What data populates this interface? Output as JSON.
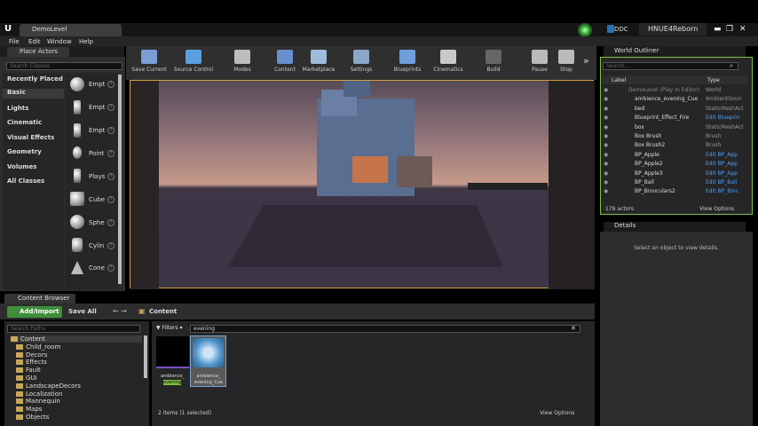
{
  "window": {
    "doc_tab": "DemoLevel",
    "project": "HNUE4Reborn",
    "ddc": "DDC"
  },
  "menu": [
    "File",
    "Edit",
    "Window",
    "Help"
  ],
  "place_actors": {
    "tab": "Place Actors",
    "search_placeholder": "Search Classes",
    "categories": [
      "Recently Placed",
      "Basic",
      "Lights",
      "Cinematic",
      "Visual Effects",
      "Geometry",
      "Volumes",
      "All Classes"
    ],
    "items": [
      "Empt",
      "Empt",
      "Empt",
      "Point",
      "Plays",
      "Cube",
      "Sphe",
      "Cylin",
      "Cone"
    ]
  },
  "toolbar": [
    {
      "label": "Save Current",
      "color": "#7a9fd6"
    },
    {
      "label": "Source Control",
      "color": "#5aa0e0"
    },
    {
      "label": "Modes",
      "color": "#bdbdbd"
    },
    {
      "label": "Content",
      "color": "#6a8fd0"
    },
    {
      "label": "Marketplace",
      "color": "#9ebbdc"
    },
    {
      "label": "Settings",
      "color": "#8aa6c8"
    },
    {
      "label": "Blueprints",
      "color": "#6f9edc"
    },
    {
      "label": "Cinematics",
      "color": "#c9c9c9"
    },
    {
      "label": "Build",
      "color": "#666666"
    },
    {
      "label": "Pause",
      "color": "#bbbbbb"
    },
    {
      "label": "Stop",
      "color": "#bbbbbb"
    }
  ],
  "outliner": {
    "tab": "World Outliner",
    "search_placeholder": "Search...",
    "col_label": "Label",
    "col_type": "Type",
    "rows": [
      {
        "label": "DemoLevel (Play In Editor)",
        "type": "World",
        "link": false
      },
      {
        "label": "ambience_evening_Cue",
        "type": "AmbientSoun",
        "link": false
      },
      {
        "label": "bed",
        "type": "StaticMeshAct",
        "link": false
      },
      {
        "label": "Blueprint_Effect_Fire",
        "type": "Edit Blueprin",
        "link": true
      },
      {
        "label": "box",
        "type": "StaticMeshAct",
        "link": false
      },
      {
        "label": "Box Brush",
        "type": "Brush",
        "link": false
      },
      {
        "label": "Box Brush2",
        "type": "Brush",
        "link": false
      },
      {
        "label": "BP_Apple",
        "type": "Edit BP_App",
        "link": true
      },
      {
        "label": "BP_Apple2",
        "type": "Edit BP_App",
        "link": true
      },
      {
        "label": "BP_Apple3",
        "type": "Edit BP_App",
        "link": true
      },
      {
        "label": "BP_Ball",
        "type": "Edit BP_Ball",
        "link": true
      },
      {
        "label": "BP_Binoculars2",
        "type": "Edit BP_Binc",
        "link": true
      }
    ],
    "count": "179 actors",
    "view_options": "View Options"
  },
  "details": {
    "tab": "Details",
    "message": "Select an object to view details."
  },
  "content_browser": {
    "tab": "Content Browser",
    "add_import": "Add/Import",
    "save_all": "Save All",
    "path": "Content",
    "search_paths_placeholder": "Search Paths",
    "filters": "Filters",
    "filter_value": "evening",
    "tree": [
      "Content",
      "Child_room",
      "Decors",
      "Effects",
      "Fault",
      "GUI",
      "LandscapeDecors",
      "Localization",
      "Mannequin",
      "Maps",
      "Objects"
    ],
    "assets": [
      {
        "line1": "ambience_",
        "line2": "evening"
      },
      {
        "line1": "ambience_",
        "line2": "evening_Cue"
      }
    ],
    "status": "2 items (1 selected)",
    "view_options": "View Options"
  }
}
